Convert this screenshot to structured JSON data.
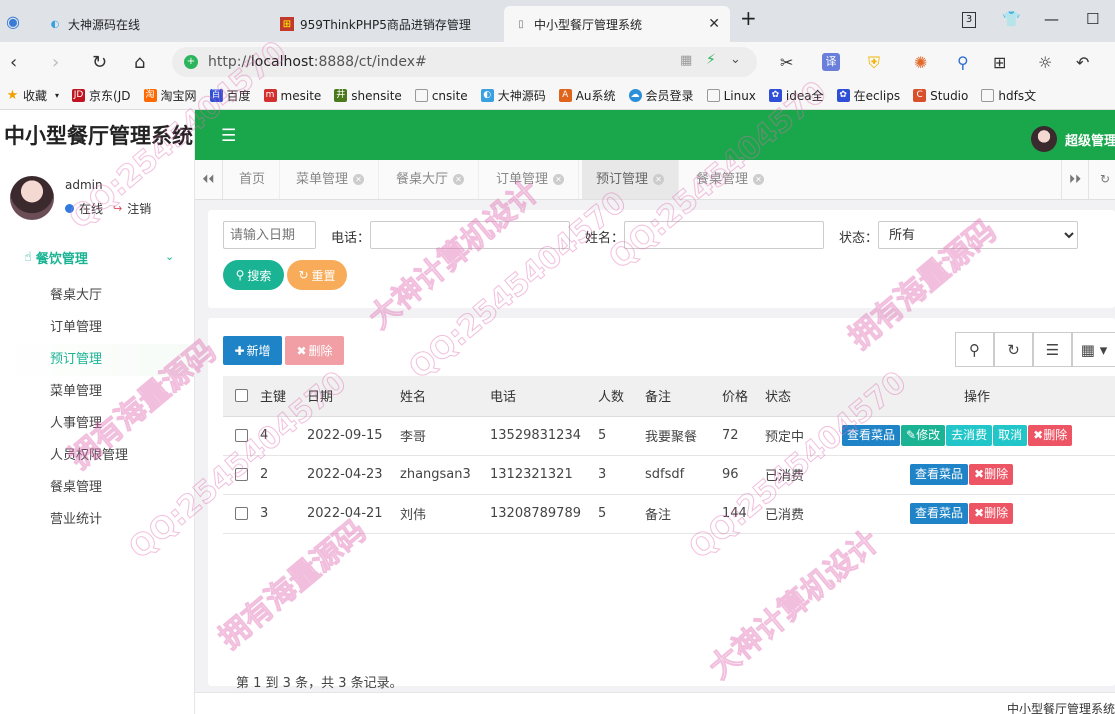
{
  "browser": {
    "tabs": [
      {
        "title": "大神源码在线",
        "active": false
      },
      {
        "title": "959ThinkPHP5商品进销存管理",
        "active": false
      },
      {
        "title": "中小型餐厅管理系统",
        "active": true
      }
    ],
    "tab_count": "3",
    "url_prefix": "http://",
    "url_host": "localhost",
    "url_rest": ":8888/ct/index#",
    "bookmarks": [
      "收藏",
      "京东(JD",
      "淘宝网",
      "百度",
      "mesite",
      "shensite",
      "cnsite",
      "大神源码",
      "Au系统",
      "会员登录",
      "Linux",
      "idea全",
      "在eclips",
      "Studio",
      "hdfs文"
    ]
  },
  "app": {
    "brand": "中小型餐厅管理系统",
    "user": {
      "name": "admin",
      "status": "在线",
      "logout": "注销"
    },
    "admin_label": "超级管理员",
    "menu": {
      "group": "餐饮管理",
      "items": [
        "餐桌大厅",
        "订单管理",
        "预订管理",
        "菜单管理",
        "人事管理",
        "人员权限管理",
        "餐桌管理",
        "营业统计"
      ],
      "active_index": 2
    },
    "tabs": [
      "首页",
      "菜单管理",
      "餐桌大厅",
      "订单管理",
      "预订管理",
      "餐桌管理"
    ],
    "active_tab": 4
  },
  "search": {
    "date_placeholder": "请输入日期",
    "phone_label": "电话：",
    "name_label": "姓名：",
    "status_label": "状态：",
    "status_value": "所有",
    "search_btn": "搜索",
    "reset_btn": "重置"
  },
  "toolbar": {
    "add": "新增",
    "delete": "删除"
  },
  "table": {
    "headers": [
      "主键",
      "日期",
      "姓名",
      "电话",
      "人数",
      "备注",
      "价格",
      "状态",
      "操作"
    ],
    "rows": [
      {
        "id": "4",
        "date": "2022-09-15",
        "name": "李哥",
        "phone": "13529831234",
        "people": "5",
        "note": "我要聚餐",
        "price": "72",
        "status": "预定中",
        "actions": [
          "查看菜品",
          "修改",
          "去消费",
          "取消",
          "删除"
        ]
      },
      {
        "id": "2",
        "date": "2022-04-23",
        "name": "zhangsan3",
        "phone": "1312321321",
        "people": "3",
        "note": "sdfsdf",
        "price": "96",
        "status": "已消费",
        "actions": [
          "查看菜品",
          "删除"
        ]
      },
      {
        "id": "3",
        "date": "2022-04-21",
        "name": "刘伟",
        "phone": "13208789789",
        "people": "5",
        "note": "备注",
        "price": "144",
        "status": "已消费",
        "actions": [
          "查看菜品",
          "删除"
        ]
      }
    ],
    "summary": "第 1 到 3 条，共 3 条记录。"
  },
  "footer": "中小型餐厅管理系统",
  "watermarks": [
    "QQ:2545404570",
    "大神计算机设计",
    "拥有海量源码"
  ],
  "colors": {
    "primary": "#1aa64b",
    "teal": "#1ab394",
    "blue": "#1f83c7",
    "red": "#ed5565",
    "orange": "#f8ac59",
    "disabled_red": "#f19fa4"
  }
}
